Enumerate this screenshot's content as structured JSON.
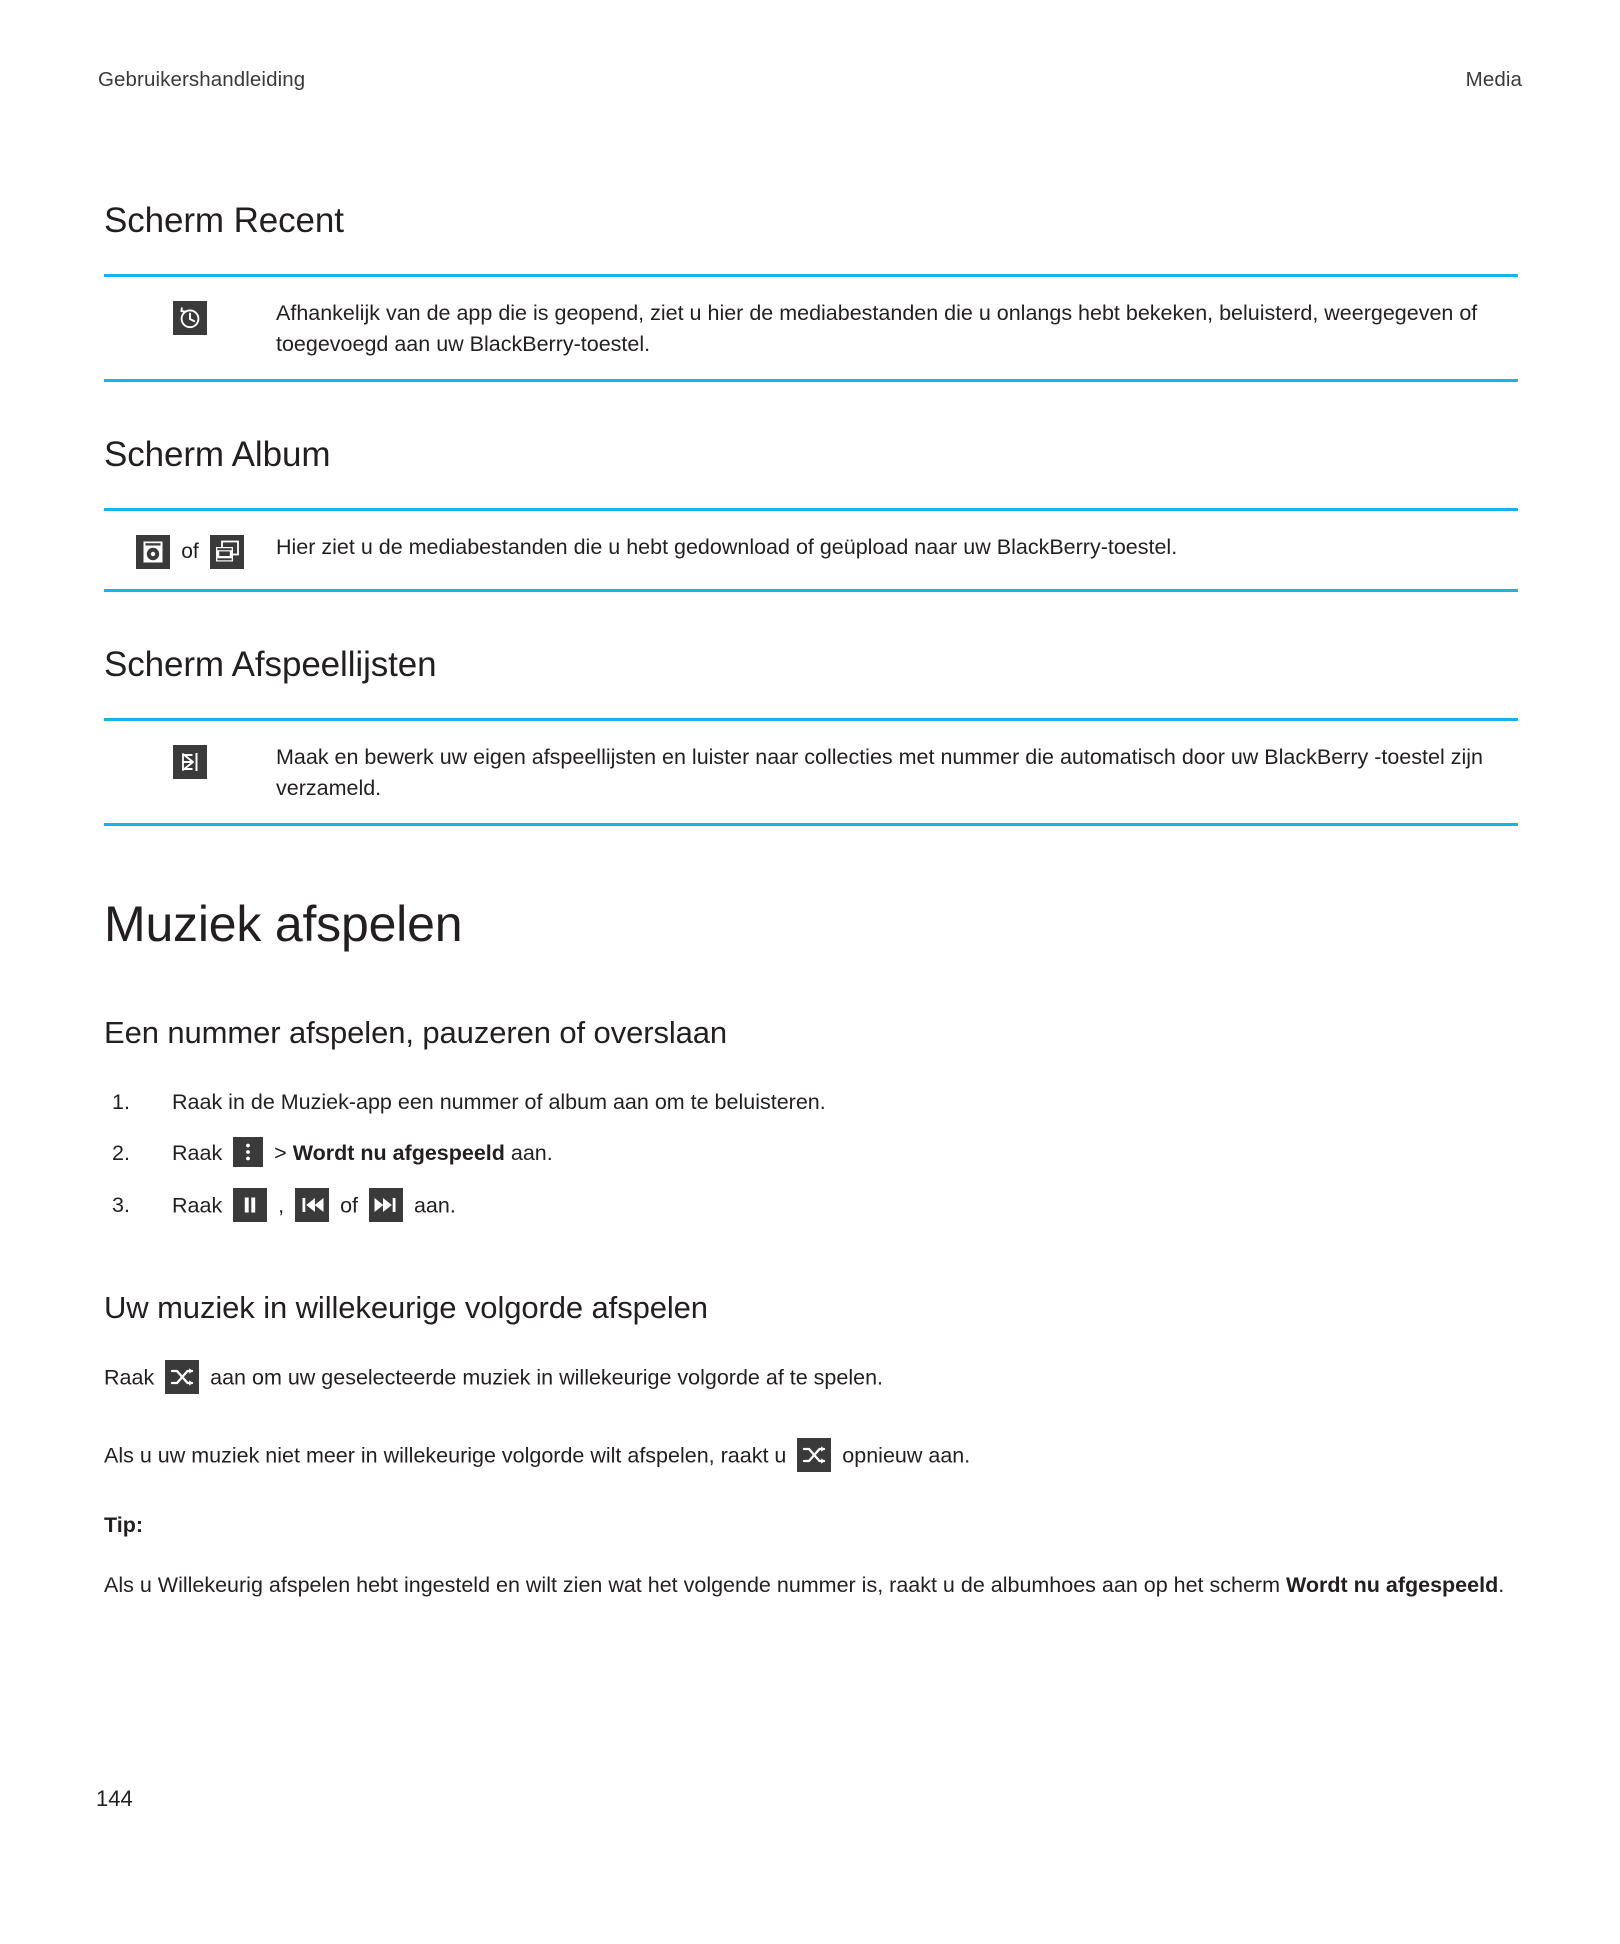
{
  "header": {
    "left": "Gebruikershandleiding",
    "right": "Media"
  },
  "sections": [
    {
      "heading": "Scherm Recent",
      "icons": [
        "recent-clock-icon"
      ],
      "description": "Afhankelijk van de app die is geopend, ziet u hier de mediabestanden die u onlangs hebt bekeken, beluisterd, weergegeven of toegevoegd aan uw BlackBerry-toestel."
    },
    {
      "heading": "Scherm Album",
      "icons": [
        "camera-album-icon",
        "media-stack-icon"
      ],
      "icon_separator": "of",
      "description": "Hier ziet u de mediabestanden die u hebt gedownload of geüpload naar uw BlackBerry-toestel."
    },
    {
      "heading": "Scherm Afspeellijsten",
      "icons": [
        "playlist-icon"
      ],
      "description": "Maak en bewerk uw eigen afspeellijsten en luister naar collecties met nummer die automatisch door uw BlackBerry -toestel zijn verzameld."
    }
  ],
  "chapter": {
    "title": "Muziek afspelen"
  },
  "subsection_play": {
    "title": "Een nummer afspelen, pauzeren of overslaan",
    "steps": [
      {
        "num": "1.",
        "parts": [
          {
            "type": "text",
            "value": "Raak in de Muziek-app een nummer of album aan om te beluisteren."
          }
        ]
      },
      {
        "num": "2.",
        "parts": [
          {
            "type": "text",
            "value": "Raak "
          },
          {
            "type": "icon",
            "value": "overflow-menu-icon"
          },
          {
            "type": "text",
            "value": " > "
          },
          {
            "type": "bold",
            "value": "Wordt nu afgespeeld"
          },
          {
            "type": "text",
            "value": " aan."
          }
        ]
      },
      {
        "num": "3.",
        "parts": [
          {
            "type": "text",
            "value": "Raak "
          },
          {
            "type": "icon",
            "value": "pause-icon"
          },
          {
            "type": "text",
            "value": " , "
          },
          {
            "type": "icon",
            "value": "previous-track-icon"
          },
          {
            "type": "text",
            "value": " of "
          },
          {
            "type": "icon",
            "value": "next-track-icon"
          },
          {
            "type": "text",
            "value": " aan."
          }
        ]
      }
    ]
  },
  "subsection_shuffle": {
    "title": "Uw muziek in willekeurige volgorde afspelen",
    "para1_before": "Raak ",
    "para1_icon": "shuffle-icon",
    "para1_after": " aan om uw geselecteerde muziek in willekeurige volgorde af te spelen.",
    "para2_before": "Als u uw muziek niet meer in willekeurige volgorde wilt afspelen, raakt u ",
    "para2_icon": "shuffle-icon",
    "para2_after": " opnieuw aan.",
    "tip_label": "Tip:",
    "tip_before": "Als u Willekeurig afspelen hebt ingesteld en wilt zien wat het volgende nummer is, raakt u de albumhoes aan op het scherm ",
    "tip_bold": "Wordt nu afgespeeld",
    "tip_after": "."
  },
  "footer": {
    "page_number": "144"
  },
  "colors": {
    "rule": "#17b4e9",
    "icon_bg": "#3a3a3a",
    "text": "#231f20"
  }
}
